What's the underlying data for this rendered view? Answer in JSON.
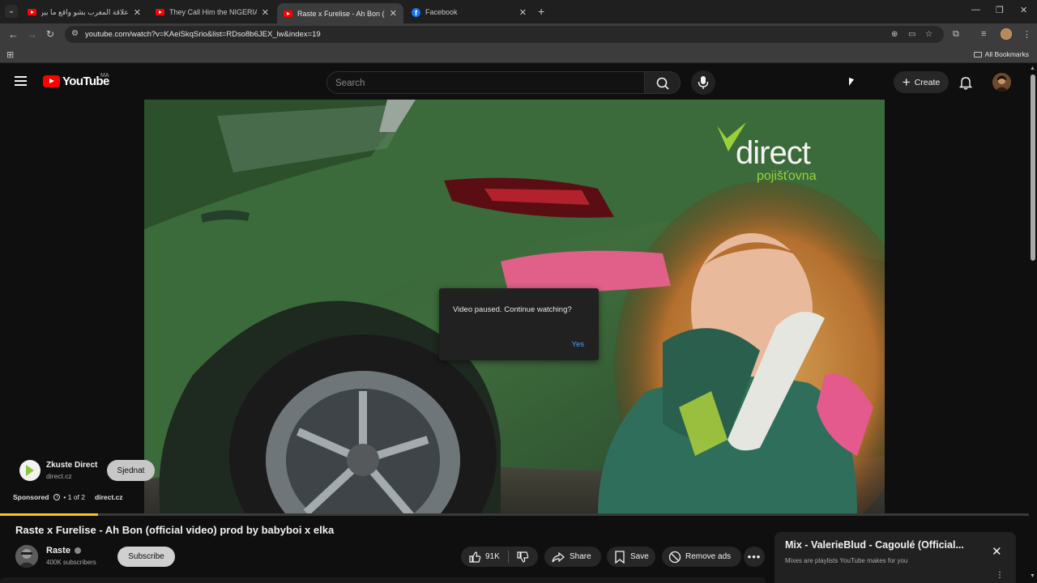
{
  "browser": {
    "tabs": [
      {
        "title": "علاقة المغرب بشو واقع ما بين ال",
        "favicon": "youtube-icon",
        "active": false
      },
      {
        "title": "They Call Him the NIGERIAN H",
        "favicon": "youtube-icon",
        "active": false
      },
      {
        "title": "Raste x Furelise - Ah Bon (offici",
        "favicon": "youtube-icon",
        "active": true
      },
      {
        "title": "Facebook",
        "favicon": "facebook-icon",
        "active": false
      }
    ],
    "close_glyph": "✕",
    "new_tab_glyph": "+",
    "url": "youtube.com/watch?v=KAeiSkqSrio&list=RDso8b6JEX_lw&index=19",
    "all_bookmarks_label": "All Bookmarks"
  },
  "masthead": {
    "logo_text": "YouTube",
    "region": "MA",
    "search_placeholder": "Search",
    "create_label": "Create"
  },
  "player": {
    "ad_brand": "direct",
    "ad_brand_sub": "pojišťovna",
    "pause_dialog": {
      "message": "Video paused. Continue watching?",
      "confirm_label": "Yes"
    },
    "ad": {
      "advertiser": "Zkuste Direct",
      "domain": "direct.cz",
      "cta_label": "Sjednat",
      "sponsored_label": "Sponsored",
      "ad_position": "• 1 of 2",
      "display_domain": "direct.cz"
    },
    "progress_fraction": 0.095
  },
  "video": {
    "title": "Raste x Furelise - Ah Bon (official video) prod by babyboi x elka",
    "channel": {
      "name": "Raste",
      "subscribers": "400K subscribers",
      "subscribe_label": "Subscribe"
    },
    "actions": {
      "like_count": "91K",
      "share_label": "Share",
      "save_label": "Save",
      "remove_ads_label": "Remove ads",
      "more_label": "•••"
    }
  },
  "mix": {
    "title": "Mix - ValerieBlud - Cagoulé (Official...",
    "subtitle": "Mixes are playlists YouTube makes for you",
    "close_glyph": "✕",
    "kebab_glyph": "⋮"
  },
  "colors": {
    "youtube_red": "#ff0000",
    "link_blue": "#3ea6ff",
    "progress_yellow": "#f5c518",
    "brand_green": "#9ad13a"
  }
}
